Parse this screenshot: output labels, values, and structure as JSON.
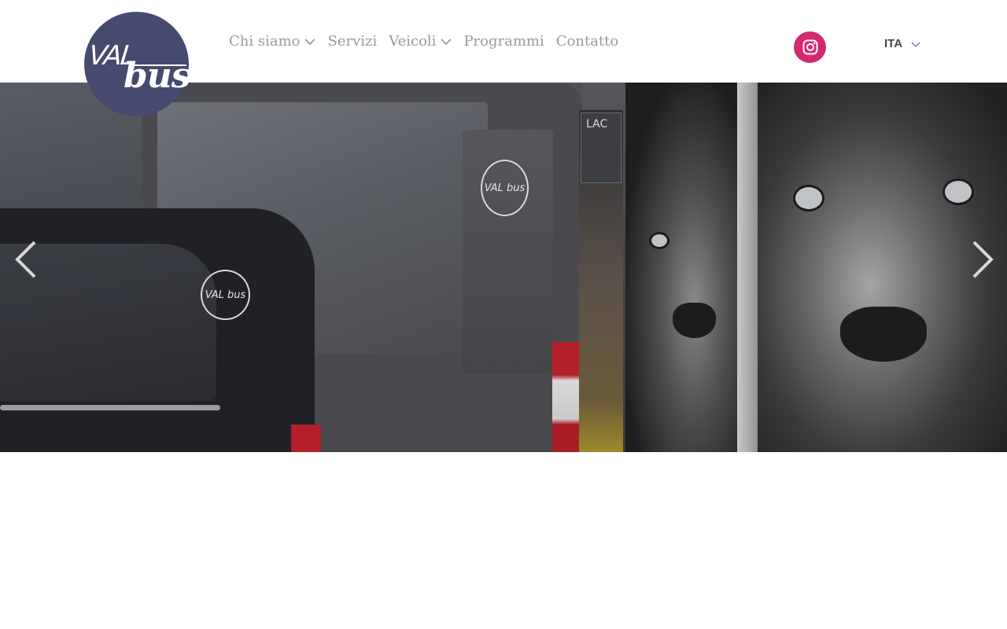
{
  "header": {
    "logo": {
      "top_text": "VAL",
      "bottom_text": "bus",
      "color": "#454a6e"
    },
    "nav": [
      {
        "label": "Chi siamo",
        "has_dropdown": true
      },
      {
        "label": "Servizi",
        "has_dropdown": false
      },
      {
        "label": "Veicoli",
        "has_dropdown": true
      },
      {
        "label": "Programmi",
        "has_dropdown": false
      },
      {
        "label": "Contatto",
        "has_dropdown": false
      }
    ],
    "social": {
      "icon": "instagram-icon",
      "color": "#d42a6f"
    },
    "language": {
      "selected": "ITA"
    }
  },
  "hero": {
    "badge_text": "VAL bus",
    "sign_text": "LAC",
    "prev_icon": "chevron-left-icon",
    "next_icon": "chevron-right-icon"
  }
}
